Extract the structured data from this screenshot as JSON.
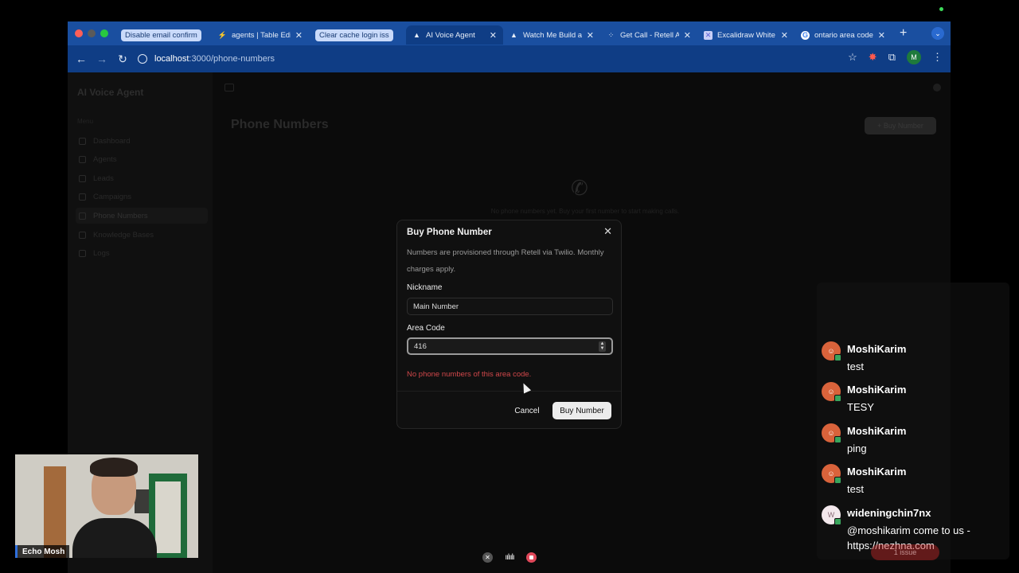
{
  "browser": {
    "tabs": [
      {
        "title": "Disable email confirm",
        "style": "pill"
      },
      {
        "title": "agents | Table Editor",
        "style": "normal"
      },
      {
        "title": "Clear cache login iss",
        "style": "pill"
      },
      {
        "title": "AI Voice Agent",
        "style": "active"
      },
      {
        "title": "Watch Me Build a",
        "style": "normal"
      },
      {
        "title": "Get Call - Retell A",
        "style": "normal"
      },
      {
        "title": "Excalidraw White",
        "style": "normal"
      },
      {
        "title": "ontario area code",
        "style": "normal"
      }
    ],
    "url_host": "localhost",
    "url_path": ":3000/phone-numbers",
    "profile_initial": "M"
  },
  "app": {
    "sidebar_title": "AI Voice Agent",
    "sidebar_group": "Menu",
    "sidebar_items": [
      "Dashboard",
      "Agents",
      "Leads",
      "Campaigns",
      "Phone Numbers",
      "Knowledge Bases",
      "Logs"
    ],
    "page_title": "Phone Numbers",
    "buy_button": "+ Buy Number",
    "empty_text": "No phone numbers yet. Buy your first number to start making calls."
  },
  "modal": {
    "title": "Buy Phone Number",
    "description": "Numbers are provisioned through Retell via Twilio. Monthly charges apply.",
    "nickname_label": "Nickname",
    "nickname_value": "Main Number",
    "area_code_label": "Area Code",
    "area_code_value": "416",
    "error": "No phone numbers of this area code.",
    "cancel_label": "Cancel",
    "buy_label": "Buy Number"
  },
  "chat": {
    "messages": [
      {
        "user": "MoshiKarim",
        "text": "test"
      },
      {
        "user": "MoshiKarim",
        "text": "TESY"
      },
      {
        "user": "MoshiKarim",
        "text": "ping"
      },
      {
        "user": "MoshiKarim",
        "text": "test"
      },
      {
        "user": "wideningchin7nx",
        "text": "@moshikarim come to us - https://nezhna.com"
      }
    ],
    "issue_badge": "1 issue"
  },
  "webcam": {
    "name": "Echo Mosh"
  },
  "colors": {
    "tab_bar": "#1a4fa0",
    "toolbar": "#0f3d85",
    "error": "#d0474a",
    "record": "#e0485a"
  }
}
